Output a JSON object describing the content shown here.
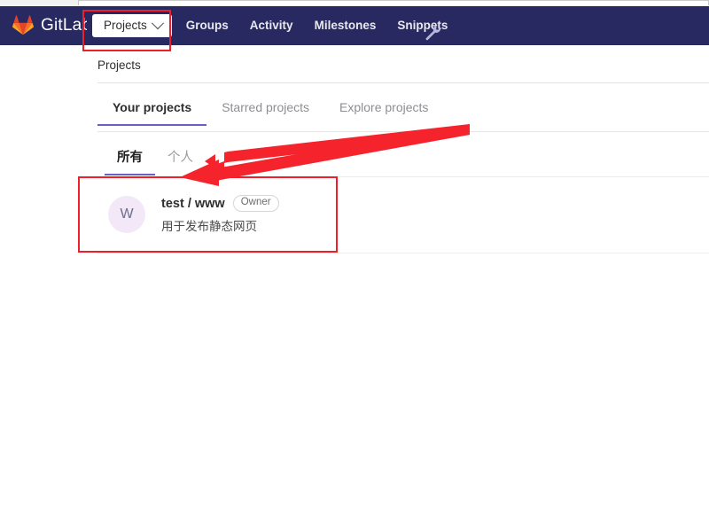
{
  "browser": {
    "address_bar_value": ""
  },
  "navbar": {
    "brand_name": "GitLab",
    "brand_logo_icon": "gitlab-fox-logo",
    "projects_dropdown_label": "Projects",
    "dropdown_caret_icon": "chevron-down-icon",
    "links": [
      {
        "label": "Groups"
      },
      {
        "label": "Activity"
      },
      {
        "label": "Milestones"
      },
      {
        "label": "Snippets"
      }
    ],
    "admin_icon": "wrench-icon",
    "background_color": "#292961"
  },
  "breadcrumb": {
    "label": "Projects"
  },
  "main_tabs": [
    {
      "label": "Your projects",
      "active": true
    },
    {
      "label": "Starred projects",
      "active": false
    },
    {
      "label": "Explore projects",
      "active": false
    }
  ],
  "sub_tabs": [
    {
      "label": "所有",
      "active": true
    },
    {
      "label": "个人",
      "active": false
    }
  ],
  "project": {
    "avatar_initial": "W",
    "avatar_color": "#f3e8f7",
    "name": "test / www",
    "role_badge": "Owner",
    "description": "用于发布静态网页"
  },
  "annotations": {
    "accent_color": "#ee1f28",
    "highlight_projects_dropdown": "red-rectangle",
    "highlight_project_card": "red-rectangle",
    "pointer": "red-arrow"
  },
  "theme": {
    "active_tab_underline_color": "#6b5fc7"
  }
}
